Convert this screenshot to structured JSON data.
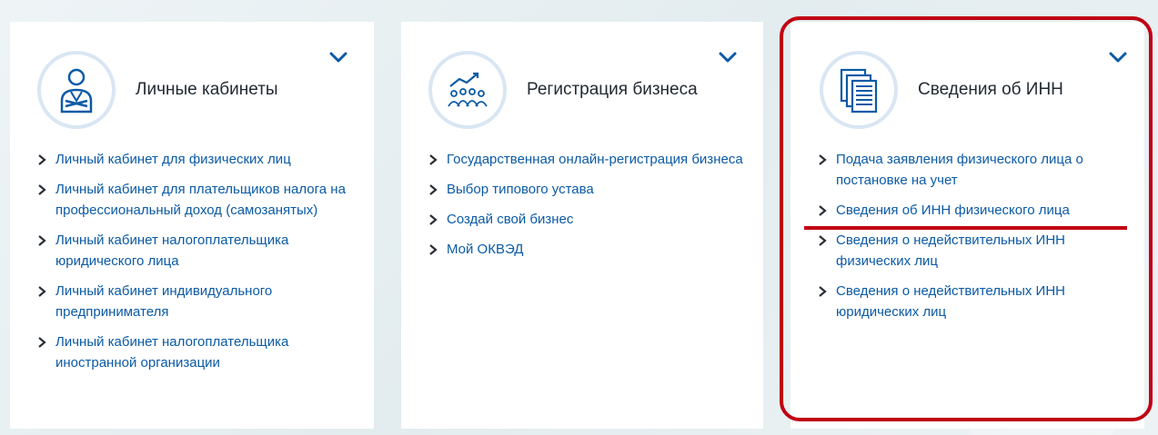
{
  "cards": [
    {
      "title": "Личные кабинеты",
      "icon": "person-cabinet-icon",
      "links": [
        "Личный кабинет для физических лиц",
        "Личный кабинет для плательщиков налога на профессиональный доход (самозанятых)",
        "Личный кабинет налогоплательщика юридического лица",
        "Личный кабинет индивидуального предпринимателя",
        "Личный кабинет налогоплательщика иностранной организации"
      ]
    },
    {
      "title": "Регистрация бизнеса",
      "icon": "business-growth-icon",
      "links": [
        "Государственная онлайн-регистрация бизнеса",
        "Выбор типового устава",
        "Создай свой бизнес",
        "Мой ОКВЭД"
      ]
    },
    {
      "title": "Сведения об ИНН",
      "icon": "documents-stack-icon",
      "links": [
        "Подача заявления физического лица о постановке на учет",
        "Сведения об ИНН физического лица",
        "Сведения о недействительных ИНН физических лиц",
        "Сведения о недействительных ИНН юридических лиц"
      ]
    }
  ],
  "colors": {
    "link": "#0b5aa6",
    "highlight": "#c00013",
    "icon_ring": "#d9e6f3"
  }
}
